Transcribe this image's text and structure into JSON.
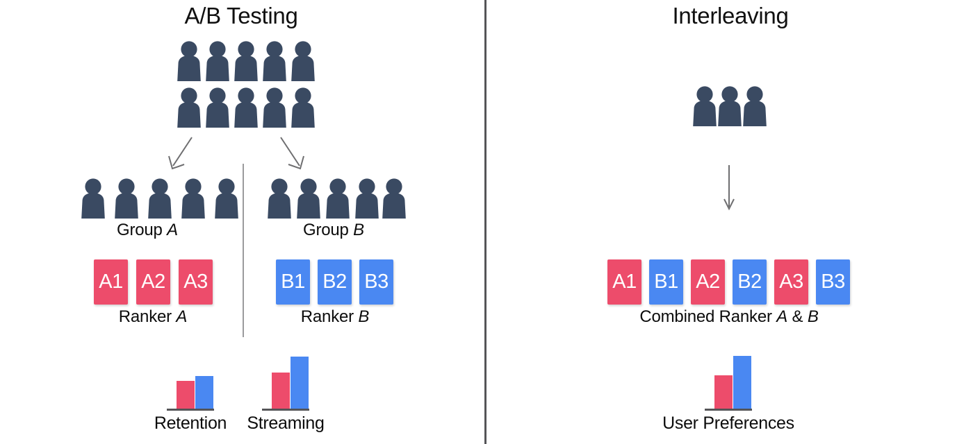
{
  "panels": {
    "left": {
      "title": "A/B Testing",
      "population_icon": "person-icon",
      "population_rows": 2,
      "population_per_row": 5,
      "groups": [
        {
          "id": "a",
          "caption_prefix": "Group ",
          "caption_letter": "A",
          "people": 5,
          "ranker_caption_prefix": "Ranker ",
          "ranker_caption_letter": "A",
          "chips": [
            "A1",
            "A2",
            "A3"
          ],
          "chip_color": "#ED4C6B"
        },
        {
          "id": "b",
          "caption_prefix": "Group ",
          "caption_letter": "B",
          "people": 5,
          "ranker_caption_prefix": "Ranker ",
          "ranker_caption_letter": "B",
          "chips": [
            "B1",
            "B2",
            "B3"
          ],
          "chip_color": "#4A88F2"
        }
      ],
      "charts": [
        {
          "label": "Retention",
          "series": [
            "A",
            "B"
          ],
          "values": [
            44,
            51
          ]
        },
        {
          "label": "Streaming",
          "series": [
            "A",
            "B"
          ],
          "values": [
            56,
            82
          ]
        }
      ]
    },
    "right": {
      "title": "Interleaving",
      "population_icon": "person-icon",
      "population_count": 3,
      "ranker_caption_prefix": "Combined Ranker ",
      "ranker_caption_letter_a": "A",
      "ranker_caption_amp": " & ",
      "ranker_caption_letter_b": "B",
      "chips": [
        {
          "label": "A1",
          "color": "#ED4C6B"
        },
        {
          "label": "B1",
          "color": "#4A88F2"
        },
        {
          "label": "A2",
          "color": "#ED4C6B"
        },
        {
          "label": "B2",
          "color": "#4A88F2"
        },
        {
          "label": "A3",
          "color": "#ED4C6B"
        },
        {
          "label": "B3",
          "color": "#4A88F2"
        }
      ],
      "charts": [
        {
          "label": "User Preferences",
          "series": [
            "A",
            "B"
          ],
          "values": [
            52,
            83
          ]
        }
      ]
    }
  },
  "icons": {
    "arrow_left": "arrow-down-left-icon",
    "arrow_right": "arrow-down-right-icon",
    "arrow_down": "arrow-down-icon"
  },
  "colors": {
    "person": "#3A4A62",
    "red": "#ED4C6B",
    "blue": "#4A88F2",
    "divider": "#555558",
    "divider_light": "#9A9A9C",
    "arrow": "#6E6E70",
    "text": "#0C0C0C"
  },
  "chart_data": [
    {
      "type": "bar",
      "title": "Retention",
      "categories": [
        "Ranker A",
        "Ranker B"
      ],
      "values": [
        44,
        51
      ],
      "xlabel": "Retention",
      "ylabel": "",
      "ylim": [
        0,
        100
      ],
      "grid": false,
      "legend": "none",
      "colors": [
        "#ED4C6B",
        "#4A88F2"
      ],
      "panel": "A/B Testing"
    },
    {
      "type": "bar",
      "title": "Streaming",
      "categories": [
        "Ranker A",
        "Ranker B"
      ],
      "values": [
        56,
        82
      ],
      "xlabel": "Streaming",
      "ylabel": "",
      "ylim": [
        0,
        100
      ],
      "grid": false,
      "legend": "none",
      "colors": [
        "#ED4C6B",
        "#4A88F2"
      ],
      "panel": "A/B Testing"
    },
    {
      "type": "bar",
      "title": "User Preferences",
      "categories": [
        "Ranker A",
        "Ranker B"
      ],
      "values": [
        52,
        83
      ],
      "xlabel": "User Preferences",
      "ylabel": "",
      "ylim": [
        0,
        100
      ],
      "grid": false,
      "legend": "none",
      "colors": [
        "#ED4C6B",
        "#4A88F2"
      ],
      "panel": "Interleaving"
    }
  ]
}
